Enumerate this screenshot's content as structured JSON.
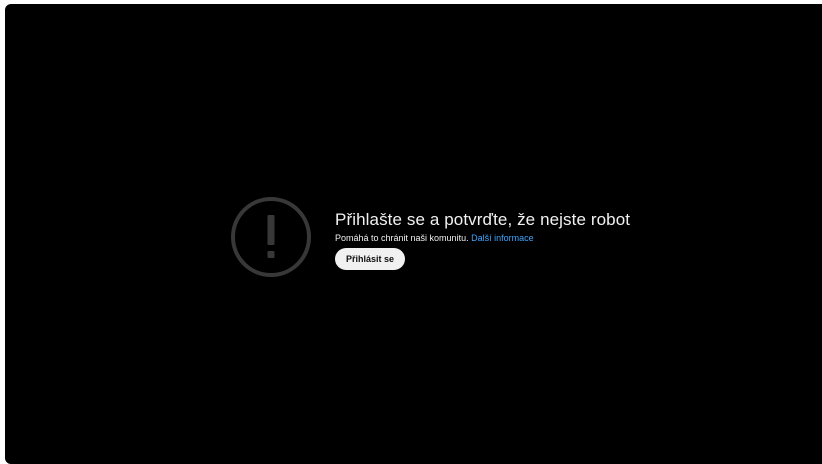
{
  "error": {
    "icon": "alert-circle-icon",
    "title": "Přihlašte se a potvrďte, že nejste robot",
    "subtitle": "Pomáhá to chránit naši komunitu.",
    "learn_more": "Další informace",
    "signin_label": "Přihlásit se"
  },
  "colors": {
    "background": "#000000",
    "text": "#f1f1f1",
    "link": "#3ea6ff",
    "icon": "#3a3a3a",
    "button_bg": "#f1f1f1",
    "button_text": "#0f0f0f"
  }
}
